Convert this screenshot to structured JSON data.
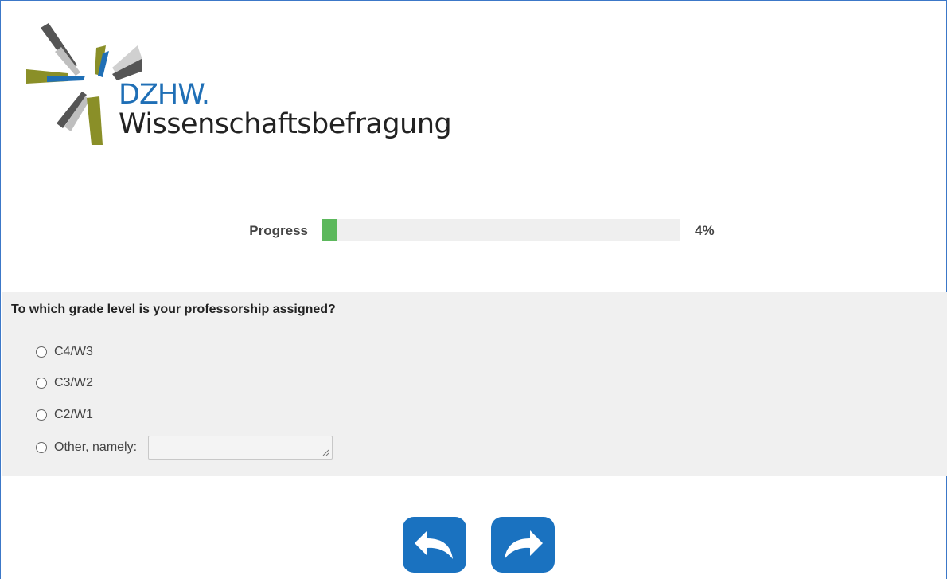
{
  "logo": {
    "title": "DZHW.",
    "subtitle": "Wissenschaftsbefragung"
  },
  "progress": {
    "label": "Progress",
    "value": 4,
    "percent_text": "4%",
    "fill_color": "#5cb85c"
  },
  "question": {
    "text": "To which grade level is your professorship assigned?",
    "options": [
      {
        "label": "C4/W3"
      },
      {
        "label": "C3/W2"
      },
      {
        "label": "C2/W1"
      },
      {
        "label": "Other, namely:"
      }
    ],
    "other_value": ""
  },
  "navigation": {
    "back_icon": "back-arrow-icon",
    "next_icon": "forward-arrow-icon",
    "button_color": "#1a72c0"
  }
}
